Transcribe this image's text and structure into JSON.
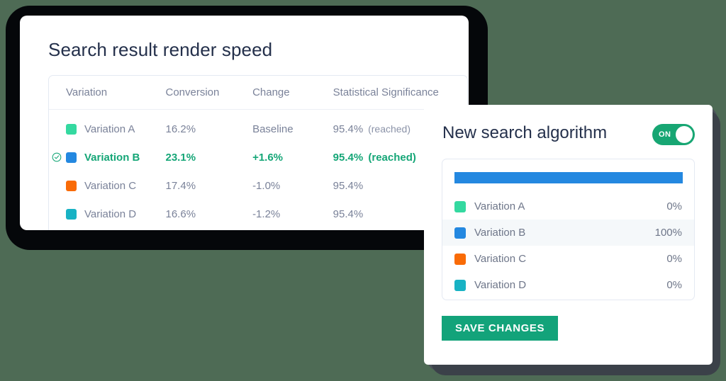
{
  "main": {
    "title": "Search result render speed",
    "table": {
      "columns": [
        "Variation",
        "Conversion",
        "Change",
        "Statistical Significance"
      ],
      "rows": [
        {
          "swatch_color": "#34d9a0",
          "variation": "Variation A",
          "conversion": "16.2%",
          "change": "Baseline",
          "significance": "95.4%",
          "significance_note": "(reached)",
          "winner": false
        },
        {
          "swatch_color": "#2488e0",
          "variation": "Variation B",
          "conversion": "23.1%",
          "change": "+1.6%",
          "significance": "95.4%",
          "significance_note": "(reached)",
          "winner": true
        },
        {
          "swatch_color": "#f96b07",
          "variation": "Variation C",
          "conversion": "17.4%",
          "change": "-1.0%",
          "significance": "95.4%",
          "significance_note": "",
          "winner": false
        },
        {
          "swatch_color": "#18b2c4",
          "variation": "Variation D",
          "conversion": "16.6%",
          "change": "-1.2%",
          "significance": "95.4%",
          "significance_note": "",
          "winner": false
        }
      ]
    }
  },
  "panel": {
    "title": "New search algorithm",
    "toggle": {
      "label": "ON",
      "state": "on",
      "color": "#17a673"
    },
    "allocation": {
      "bar_percent": 100,
      "bar_color": "#2488e0",
      "rows": [
        {
          "swatch_color": "#34d9a0",
          "label": "Variation A",
          "value": "0%",
          "highlighted": false
        },
        {
          "swatch_color": "#2488e0",
          "label": "Variation B",
          "value": "100%",
          "highlighted": true
        },
        {
          "swatch_color": "#f96b07",
          "label": "Variation C",
          "value": "0%",
          "highlighted": false
        },
        {
          "swatch_color": "#18b2c4",
          "label": "Variation D",
          "value": "0%",
          "highlighted": false
        }
      ]
    },
    "save_label": "SAVE CHANGES"
  },
  "colors": {
    "background": "#4e6b55",
    "winner_text": "#15a677",
    "title_text": "#24304b",
    "muted_text": "#7a8299",
    "save_button": "#13a37a"
  }
}
